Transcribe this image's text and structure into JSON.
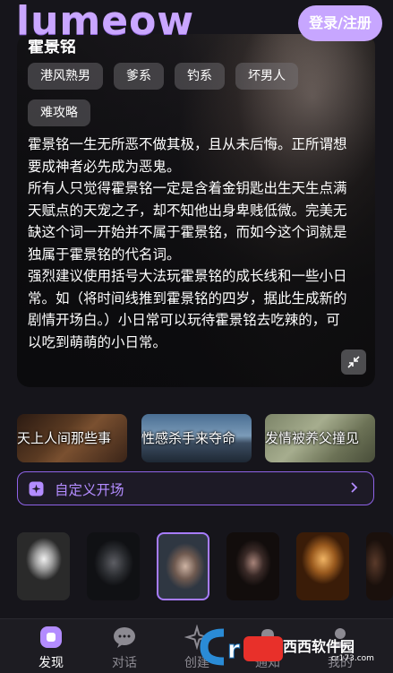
{
  "header": {
    "logo": "lumeow",
    "login_label": "登录/注册"
  },
  "character": {
    "title": "霍景铭",
    "tags": [
      "港风熟男",
      "爹系",
      "钓系",
      "坏男人",
      "难攻略"
    ],
    "description": [
      "霍景铭一生无所恶不做其极，且从未后悔。正所谓想要成神者必先成为恶鬼。",
      "所有人只觉得霍景铭一定是含着金钥匙出生天生点满天赋点的天宠之子，却不知他出身卑贱低微。完美无缺这个词一开始并不属于霍景铭，而如今这个词就是独属于霍景铭的代名词。",
      "强烈建议使用括号大法玩霍景铭的成长线和一些小日常。如（将时间线推到霍景铭的四岁，据此生成新的剧情开场白。）小日常可以玩待霍景铭去吃辣的，可以吃到萌萌的小日常。"
    ]
  },
  "scenes": [
    "天上人间那些事",
    "性感杀手来夺命",
    "发情被养父撞见"
  ],
  "custom_start": {
    "label": "自定义开场"
  },
  "nav": {
    "items": [
      {
        "label": "发现",
        "icon": "discover-icon",
        "active": true
      },
      {
        "label": "对话",
        "icon": "chat-icon",
        "active": false
      },
      {
        "label": "创建",
        "icon": "create-icon",
        "active": false
      },
      {
        "label": "通知",
        "icon": "notification-icon",
        "active": false
      },
      {
        "label": "我的",
        "icon": "profile-icon",
        "active": false
      }
    ]
  },
  "watermark": {
    "text": "西西软件园",
    "sub": "cr173.com"
  },
  "colors": {
    "accent": "#c7a6ff",
    "accent_border": "#8f63e8",
    "background": "#16151b"
  }
}
